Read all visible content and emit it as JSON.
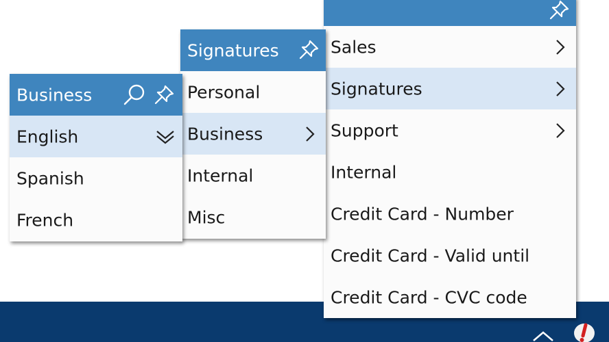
{
  "menus": {
    "language": {
      "title": "Business",
      "items": [
        {
          "label": "English"
        },
        {
          "label": "Spanish"
        },
        {
          "label": "French"
        }
      ]
    },
    "categories": {
      "title": "Signatures",
      "items": [
        {
          "label": "Personal"
        },
        {
          "label": "Business"
        },
        {
          "label": "Internal"
        },
        {
          "label": "Misc"
        }
      ]
    },
    "root": {
      "title": "",
      "items": [
        {
          "label": "Sales"
        },
        {
          "label": "Signatures"
        },
        {
          "label": "Support"
        },
        {
          "label": "Internal"
        },
        {
          "label": "Credit Card - Number"
        },
        {
          "label": "Credit Card - Valid until"
        },
        {
          "label": "Credit Card - CVC code"
        }
      ]
    }
  },
  "icons": {
    "search": "search-icon",
    "pin": "pin-icon",
    "chevron_right": "chevron-right-icon",
    "chevron_down": "chevron-down-icon",
    "tray_up": "chevron-up-icon",
    "tray_app": "app-alert-icon"
  },
  "colors": {
    "header": "#3f85be",
    "highlight": "#d8e6f5",
    "taskbar": "#0a3a6e",
    "menu_bg": "#fbfbfb"
  }
}
